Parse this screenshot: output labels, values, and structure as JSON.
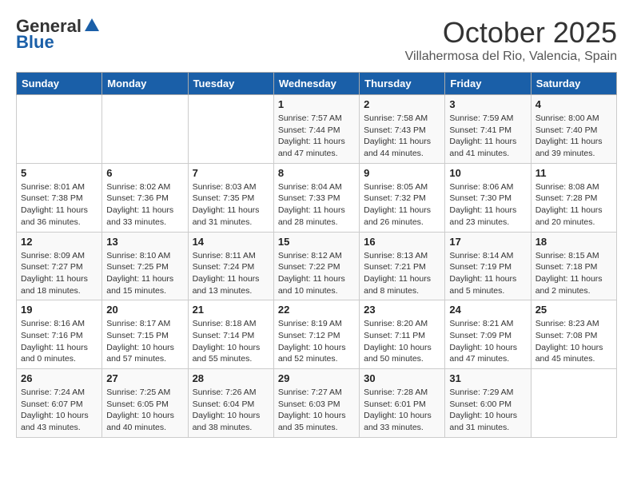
{
  "header": {
    "logo_general": "General",
    "logo_blue": "Blue",
    "month": "October 2025",
    "location": "Villahermosa del Rio, Valencia, Spain"
  },
  "days_of_week": [
    "Sunday",
    "Monday",
    "Tuesday",
    "Wednesday",
    "Thursday",
    "Friday",
    "Saturday"
  ],
  "weeks": [
    [
      {
        "day": "",
        "info": ""
      },
      {
        "day": "",
        "info": ""
      },
      {
        "day": "",
        "info": ""
      },
      {
        "day": "1",
        "info": "Sunrise: 7:57 AM\nSunset: 7:44 PM\nDaylight: 11 hours and 47 minutes."
      },
      {
        "day": "2",
        "info": "Sunrise: 7:58 AM\nSunset: 7:43 PM\nDaylight: 11 hours and 44 minutes."
      },
      {
        "day": "3",
        "info": "Sunrise: 7:59 AM\nSunset: 7:41 PM\nDaylight: 11 hours and 41 minutes."
      },
      {
        "day": "4",
        "info": "Sunrise: 8:00 AM\nSunset: 7:40 PM\nDaylight: 11 hours and 39 minutes."
      }
    ],
    [
      {
        "day": "5",
        "info": "Sunrise: 8:01 AM\nSunset: 7:38 PM\nDaylight: 11 hours and 36 minutes."
      },
      {
        "day": "6",
        "info": "Sunrise: 8:02 AM\nSunset: 7:36 PM\nDaylight: 11 hours and 33 minutes."
      },
      {
        "day": "7",
        "info": "Sunrise: 8:03 AM\nSunset: 7:35 PM\nDaylight: 11 hours and 31 minutes."
      },
      {
        "day": "8",
        "info": "Sunrise: 8:04 AM\nSunset: 7:33 PM\nDaylight: 11 hours and 28 minutes."
      },
      {
        "day": "9",
        "info": "Sunrise: 8:05 AM\nSunset: 7:32 PM\nDaylight: 11 hours and 26 minutes."
      },
      {
        "day": "10",
        "info": "Sunrise: 8:06 AM\nSunset: 7:30 PM\nDaylight: 11 hours and 23 minutes."
      },
      {
        "day": "11",
        "info": "Sunrise: 8:08 AM\nSunset: 7:28 PM\nDaylight: 11 hours and 20 minutes."
      }
    ],
    [
      {
        "day": "12",
        "info": "Sunrise: 8:09 AM\nSunset: 7:27 PM\nDaylight: 11 hours and 18 minutes."
      },
      {
        "day": "13",
        "info": "Sunrise: 8:10 AM\nSunset: 7:25 PM\nDaylight: 11 hours and 15 minutes."
      },
      {
        "day": "14",
        "info": "Sunrise: 8:11 AM\nSunset: 7:24 PM\nDaylight: 11 hours and 13 minutes."
      },
      {
        "day": "15",
        "info": "Sunrise: 8:12 AM\nSunset: 7:22 PM\nDaylight: 11 hours and 10 minutes."
      },
      {
        "day": "16",
        "info": "Sunrise: 8:13 AM\nSunset: 7:21 PM\nDaylight: 11 hours and 8 minutes."
      },
      {
        "day": "17",
        "info": "Sunrise: 8:14 AM\nSunset: 7:19 PM\nDaylight: 11 hours and 5 minutes."
      },
      {
        "day": "18",
        "info": "Sunrise: 8:15 AM\nSunset: 7:18 PM\nDaylight: 11 hours and 2 minutes."
      }
    ],
    [
      {
        "day": "19",
        "info": "Sunrise: 8:16 AM\nSunset: 7:16 PM\nDaylight: 11 hours and 0 minutes."
      },
      {
        "day": "20",
        "info": "Sunrise: 8:17 AM\nSunset: 7:15 PM\nDaylight: 10 hours and 57 minutes."
      },
      {
        "day": "21",
        "info": "Sunrise: 8:18 AM\nSunset: 7:14 PM\nDaylight: 10 hours and 55 minutes."
      },
      {
        "day": "22",
        "info": "Sunrise: 8:19 AM\nSunset: 7:12 PM\nDaylight: 10 hours and 52 minutes."
      },
      {
        "day": "23",
        "info": "Sunrise: 8:20 AM\nSunset: 7:11 PM\nDaylight: 10 hours and 50 minutes."
      },
      {
        "day": "24",
        "info": "Sunrise: 8:21 AM\nSunset: 7:09 PM\nDaylight: 10 hours and 47 minutes."
      },
      {
        "day": "25",
        "info": "Sunrise: 8:23 AM\nSunset: 7:08 PM\nDaylight: 10 hours and 45 minutes."
      }
    ],
    [
      {
        "day": "26",
        "info": "Sunrise: 7:24 AM\nSunset: 6:07 PM\nDaylight: 10 hours and 43 minutes."
      },
      {
        "day": "27",
        "info": "Sunrise: 7:25 AM\nSunset: 6:05 PM\nDaylight: 10 hours and 40 minutes."
      },
      {
        "day": "28",
        "info": "Sunrise: 7:26 AM\nSunset: 6:04 PM\nDaylight: 10 hours and 38 minutes."
      },
      {
        "day": "29",
        "info": "Sunrise: 7:27 AM\nSunset: 6:03 PM\nDaylight: 10 hours and 35 minutes."
      },
      {
        "day": "30",
        "info": "Sunrise: 7:28 AM\nSunset: 6:01 PM\nDaylight: 10 hours and 33 minutes."
      },
      {
        "day": "31",
        "info": "Sunrise: 7:29 AM\nSunset: 6:00 PM\nDaylight: 10 hours and 31 minutes."
      },
      {
        "day": "",
        "info": ""
      }
    ]
  ]
}
